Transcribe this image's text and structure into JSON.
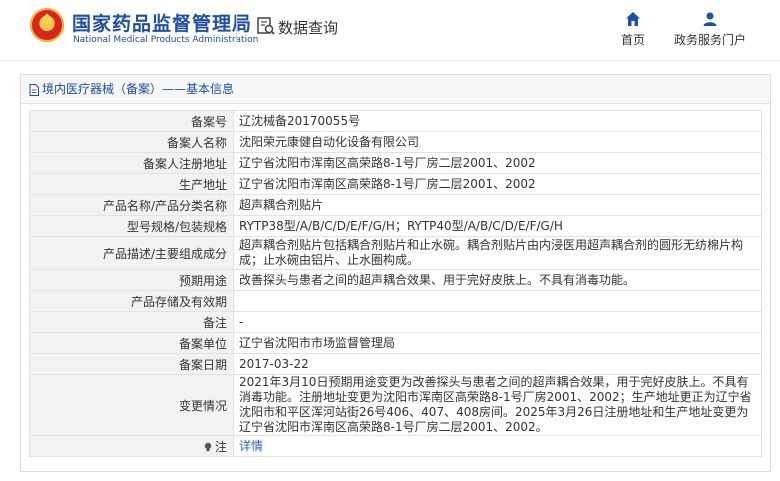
{
  "header": {
    "site_name_cn": "国家药品监督管理局",
    "site_name_en": "National Medical Products Administration",
    "query_label": "数据查询",
    "nav": [
      {
        "label": "首页",
        "icon": "home-icon"
      },
      {
        "label": "政务服务门户",
        "icon": "user-icon"
      }
    ],
    "brand_color": "#1f4fa0"
  },
  "breadcrumb": "境内医疗器械（备案）——基本信息",
  "record": {
    "rows": [
      {
        "label": "备案号",
        "value": "辽沈械备20170055号"
      },
      {
        "label": "备案人名称",
        "value": "沈阳荣元康健自动化设备有限公司"
      },
      {
        "label": "备案人注册地址",
        "value": "辽宁省沈阳市浑南区高荣路8-1号厂房二层2001、2002"
      },
      {
        "label": "生产地址",
        "value": "辽宁省沈阳市浑南区高荣路8-1号厂房二层2001、2002"
      },
      {
        "label": "产品名称/产品分类名称",
        "value": "超声耦合剂贴片"
      },
      {
        "label": "型号规格/包装规格",
        "value": "RYTP38型/A/B/C/D/E/F/G/H；RYTP40型/A/B/C/D/E/F/G/H"
      },
      {
        "label": "产品描述/主要组成成分",
        "value": "超声耦合剂贴片包括耦合剂贴片和止水碗。耦合剂贴片由内浸医用超声耦合剂的圆形无纺棉片构成；止水碗由铝片、止水圈构成。"
      },
      {
        "label": "预期用途",
        "value": "改善探头与患者之间的超声耦合效果、用于完好皮肤上。不具有消毒功能。"
      },
      {
        "label": "产品存储及有效期",
        "value": ""
      },
      {
        "label": "备注",
        "value": "-"
      },
      {
        "label": "备案单位",
        "value": "辽宁省沈阳市市场监督管理局"
      },
      {
        "label": "备案日期",
        "value": "2017-03-22"
      },
      {
        "label": "变更情况",
        "value": "2021年3月10日预期用途变更为改善探头与患者之间的超声耦合效果，用于完好皮肤上。不具有消毒功能。注册地址变更为沈阳市浑南区高荣路8-1号厂房2001、2002；生产地址更正为辽宁省沈阳市和平区浑河站街26号406、407、408房间。2025年3月26日注册地址和生产地址变更为辽宁省沈阳市浑南区高荣路8-1号厂房二层2001、2002。"
      }
    ],
    "note_label": "注",
    "note_link": "详情"
  }
}
